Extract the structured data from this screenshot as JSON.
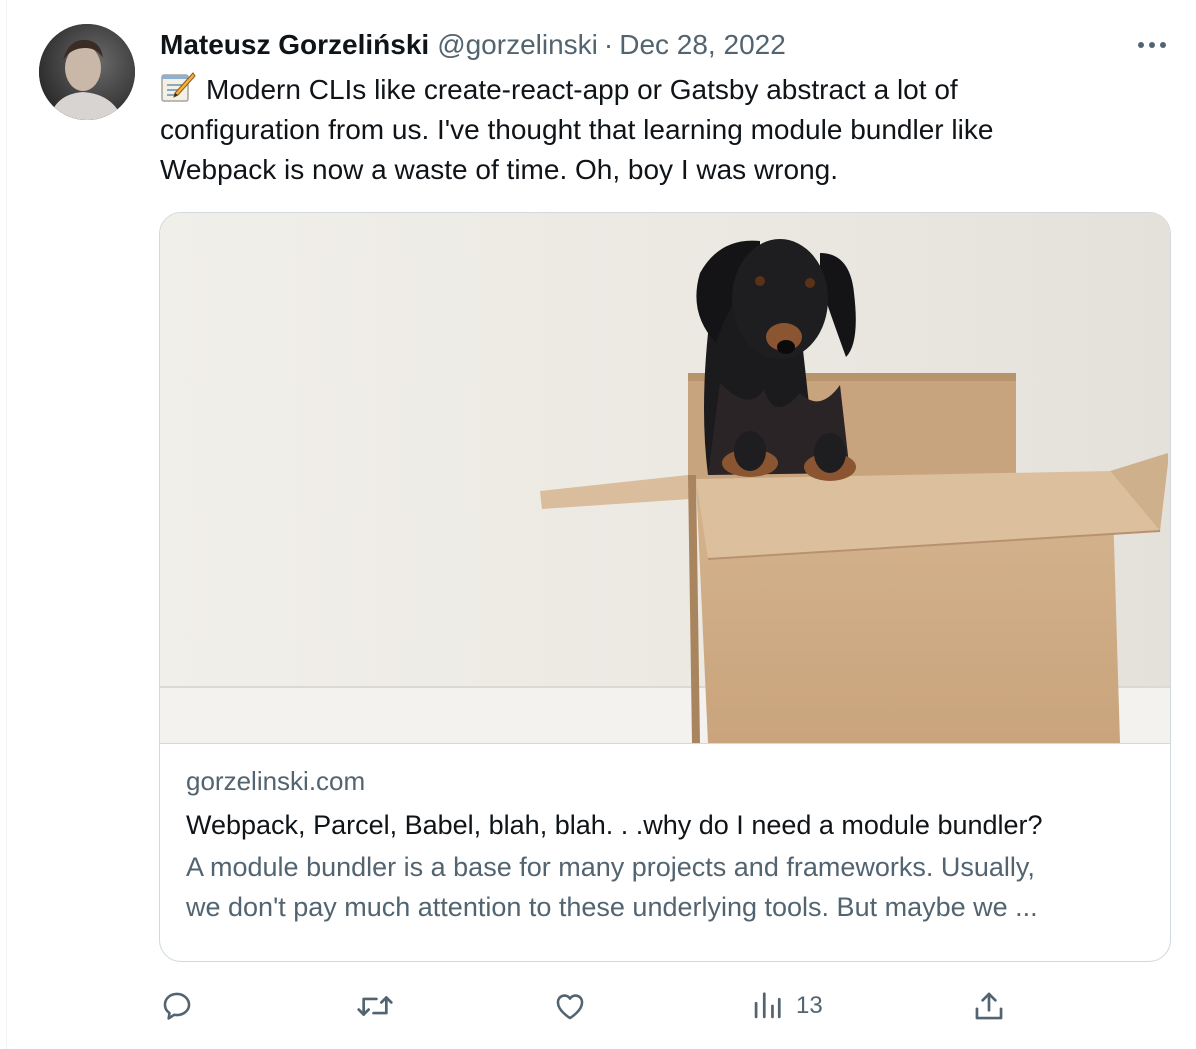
{
  "tweet": {
    "author_name": "Mateusz Gorzeliński",
    "author_handle": "@gorzelinski",
    "separator": "·",
    "date": "Dec 28, 2022",
    "text_lines": [
      "Modern CLIs like create-react-app or Gatsby abstract a lot of",
      "configuration from us. I've thought that learning module bundler like",
      "Webpack is now a waste of time. Oh, boy I was wrong."
    ],
    "leading_icon": "memo-icon"
  },
  "card": {
    "image_subject": "dachshund-in-cardboard-box",
    "domain": "gorzelinski.com",
    "title": "Webpack, Parcel, Babel, blah, blah. . .why do I need a module bundler?",
    "description_lines": [
      "A module bundler is a base for many projects and frameworks. Usually,",
      "we don't pay much attention to these underlying tools. But maybe we ..."
    ]
  },
  "actions": {
    "reply_icon": "reply-icon",
    "retweet_icon": "retweet-icon",
    "like_icon": "like-icon",
    "views_icon": "views-icon",
    "views_count": "13",
    "share_icon": "share-icon"
  },
  "colors": {
    "text": "#0f1419",
    "secondary": "#536471",
    "border": "#cfd9de"
  }
}
